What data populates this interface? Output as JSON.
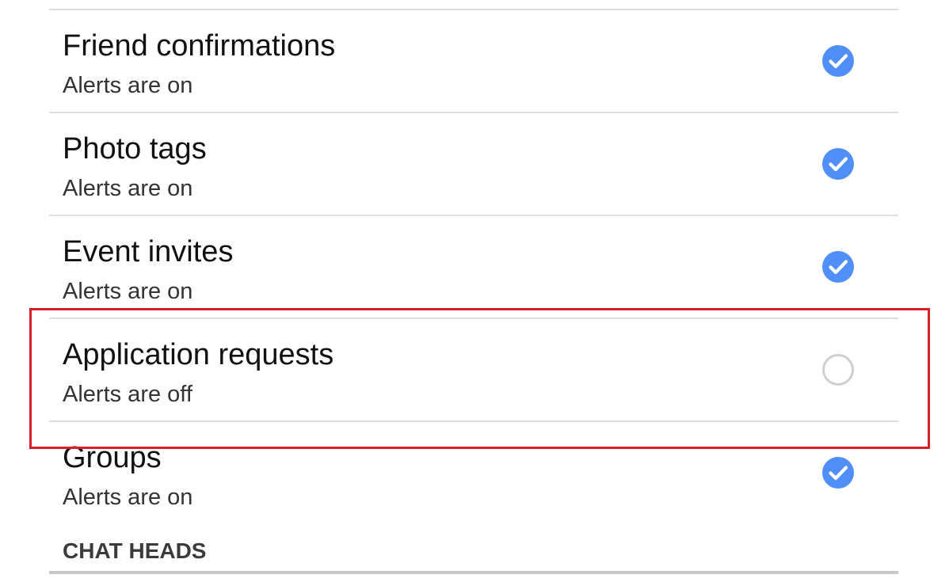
{
  "settings_list": {
    "items": [
      {
        "title": "Friend confirmations",
        "status": "Alerts are on",
        "checked": true
      },
      {
        "title": "Photo tags",
        "status": "Alerts are on",
        "checked": true
      },
      {
        "title": "Event invites",
        "status": "Alerts are on",
        "checked": true
      },
      {
        "title": "Application requests",
        "status": "Alerts are off",
        "checked": false
      },
      {
        "title": "Groups",
        "status": "Alerts are on",
        "checked": true
      }
    ]
  },
  "section_header": "CHAT HEADS",
  "colors": {
    "check_on": "#4f8ff7",
    "check_off_border": "#cfcfcf",
    "highlight": "#d61f26",
    "divider": "#dedede"
  },
  "icons": {
    "checked": "checked-circle-icon",
    "unchecked": "unchecked-circle-icon"
  }
}
